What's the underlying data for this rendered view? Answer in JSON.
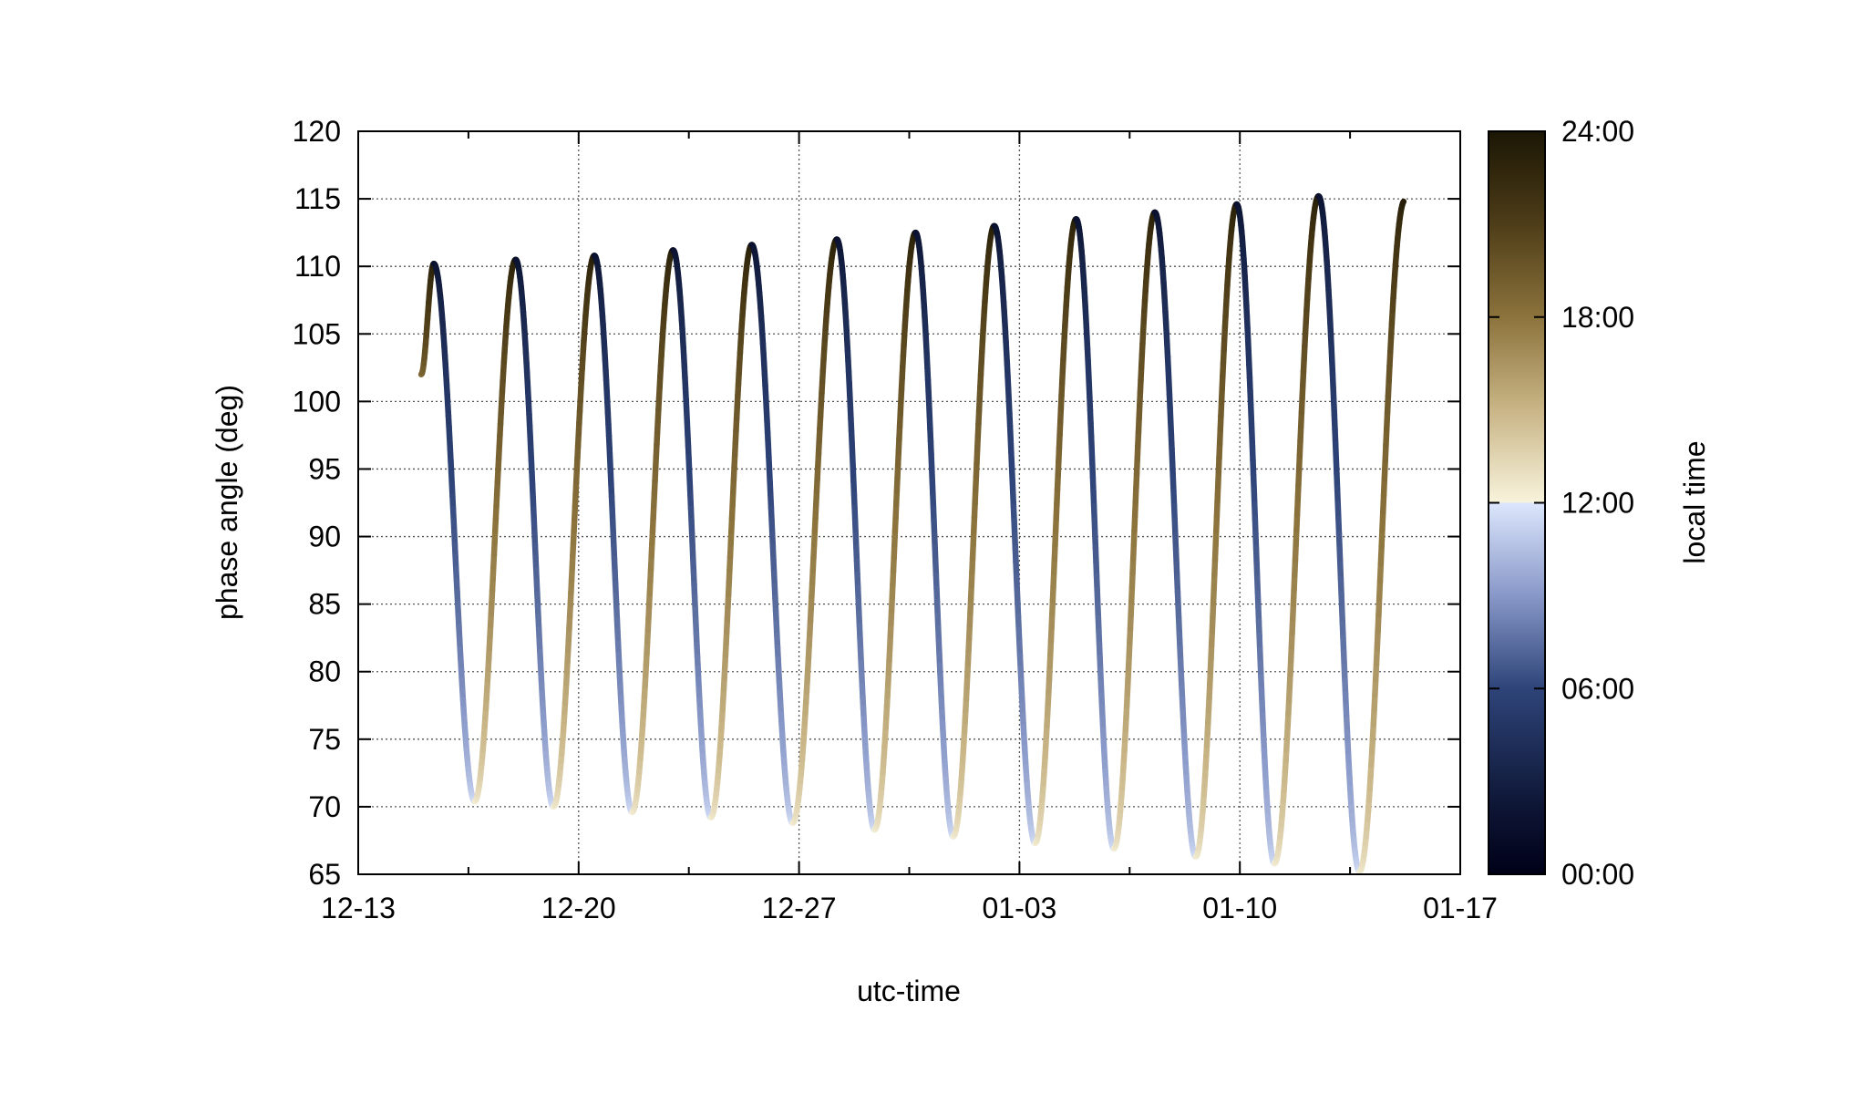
{
  "chart_data": {
    "type": "line",
    "title": "",
    "xlabel": "utc-time",
    "ylabel": "phase angle (deg)",
    "colorbar_label": "local time",
    "x_tick_labels": [
      "12-13",
      "12-20",
      "12-27",
      "01-03",
      "01-10",
      "01-17"
    ],
    "x_ticks_days": [
      0,
      7,
      14,
      21,
      28,
      35
    ],
    "xlim_days": [
      0,
      35
    ],
    "y_ticks": [
      65,
      70,
      75,
      80,
      85,
      90,
      95,
      100,
      105,
      110,
      115,
      120
    ],
    "ylim": [
      65,
      120
    ],
    "colorbar_tick_labels": [
      "00:00",
      "06:00",
      "12:00",
      "18:00",
      "24:00"
    ],
    "colorbar_range_hours": [
      0,
      24
    ],
    "colormap_stops": [
      {
        "hours": 0,
        "color": "#000018"
      },
      {
        "hours": 2.4,
        "color": "#0f1838"
      },
      {
        "hours": 6,
        "color": "#2e4479"
      },
      {
        "hours": 9,
        "color": "#8898c8"
      },
      {
        "hours": 12,
        "color": "#dce6fc"
      },
      {
        "hours": 12.01,
        "color": "#f8f3dc"
      },
      {
        "hours": 15,
        "color": "#c9b586"
      },
      {
        "hours": 18,
        "color": "#8c733c"
      },
      {
        "hours": 21,
        "color": "#4e3d18"
      },
      {
        "hours": 24,
        "color": "#1b1604"
      }
    ],
    "grid": true,
    "oscillation": {
      "start_day": 2.0,
      "start_value": 102,
      "end_day": 33.2,
      "end_value": 114.8,
      "peaks": [
        {
          "day": 2.4,
          "value": 110.2
        },
        {
          "day": 5.0,
          "value": 110.5
        },
        {
          "day": 7.5,
          "value": 110.8
        },
        {
          "day": 10.0,
          "value": 111.2
        },
        {
          "day": 12.5,
          "value": 111.6
        },
        {
          "day": 15.2,
          "value": 112.0
        },
        {
          "day": 17.7,
          "value": 112.5
        },
        {
          "day": 20.2,
          "value": 113.0
        },
        {
          "day": 22.8,
          "value": 113.5
        },
        {
          "day": 25.3,
          "value": 114.0
        },
        {
          "day": 27.9,
          "value": 114.6
        },
        {
          "day": 30.5,
          "value": 115.2
        }
      ],
      "troughs": [
        {
          "day": 3.7,
          "value": 70.4
        },
        {
          "day": 6.2,
          "value": 70.0
        },
        {
          "day": 8.7,
          "value": 69.6
        },
        {
          "day": 11.2,
          "value": 69.2
        },
        {
          "day": 13.8,
          "value": 68.8
        },
        {
          "day": 16.4,
          "value": 68.3
        },
        {
          "day": 18.9,
          "value": 67.8
        },
        {
          "day": 21.5,
          "value": 67.3
        },
        {
          "day": 24.0,
          "value": 66.9
        },
        {
          "day": 26.6,
          "value": 66.3
        },
        {
          "day": 29.1,
          "value": 65.8
        },
        {
          "day": 31.8,
          "value": 65.2
        }
      ]
    }
  }
}
